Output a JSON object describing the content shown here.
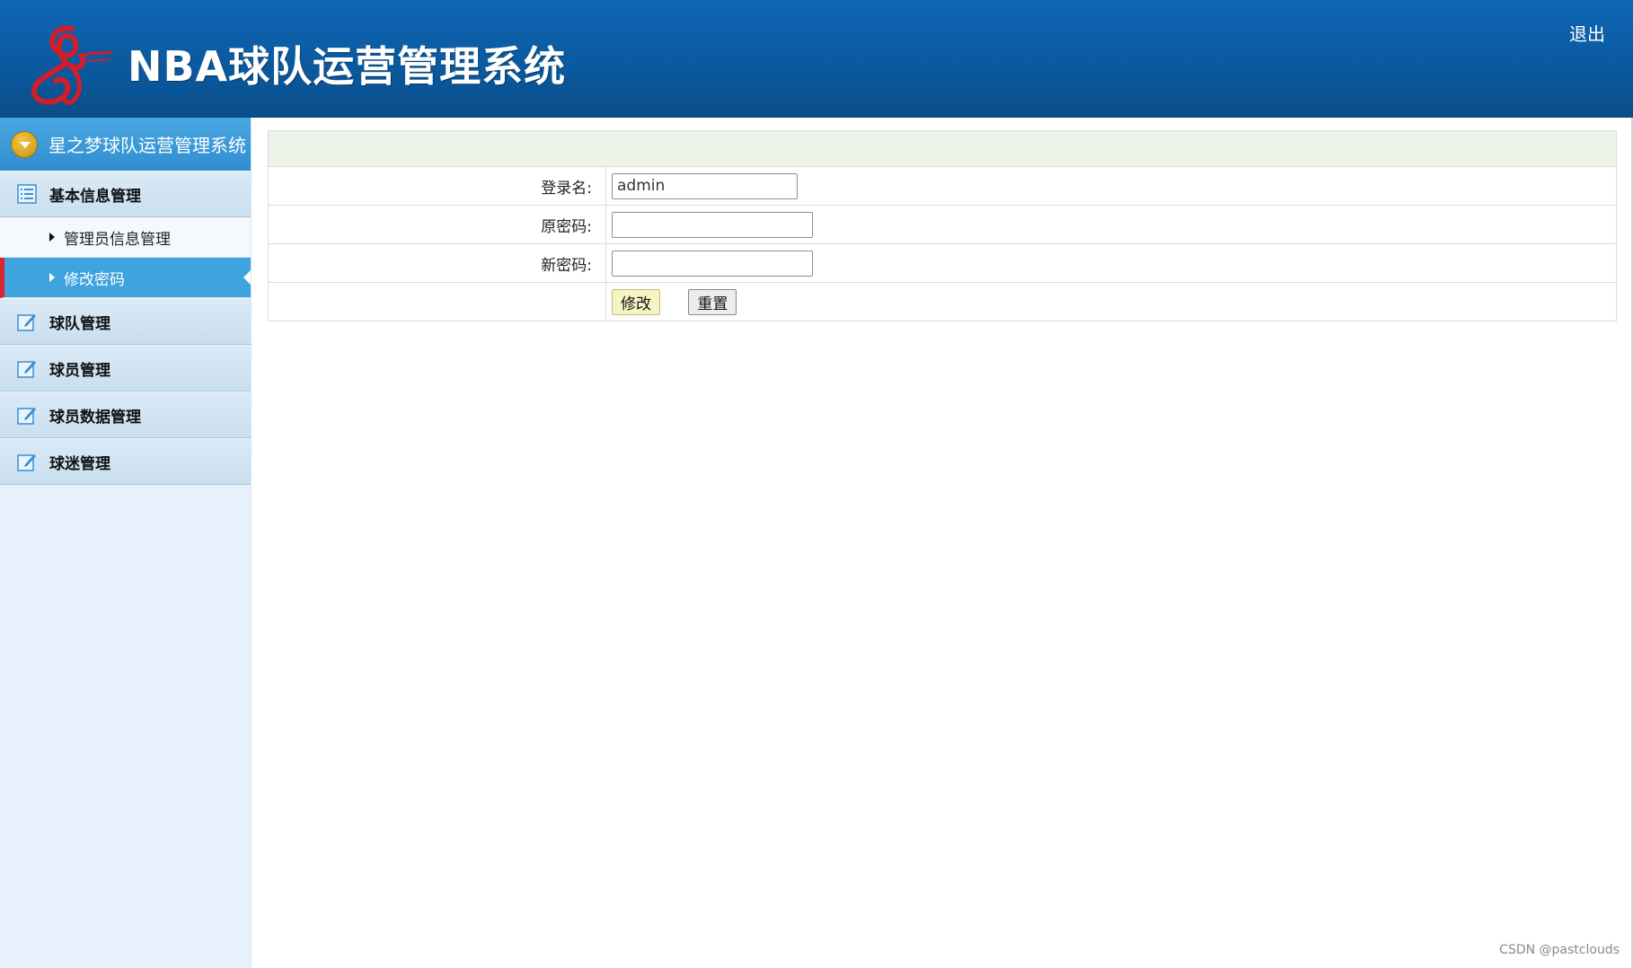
{
  "header": {
    "title": "NBA球队运营管理系统",
    "logout_label": "退出",
    "background_color": "#0b5aa0",
    "logo_icon": "red-ribbon-logo"
  },
  "sidebar": {
    "title": "星之梦球队运营管理系统",
    "groups": [
      {
        "label": "基本信息管理",
        "icon": "list-icon",
        "items": [
          {
            "label": "管理员信息管理",
            "active": false
          },
          {
            "label": "修改密码",
            "active": true
          }
        ]
      },
      {
        "label": "球队管理",
        "icon": "edit-icon",
        "items": []
      },
      {
        "label": "球员管理",
        "icon": "edit-icon",
        "items": []
      },
      {
        "label": "球员数据管理",
        "icon": "edit-icon",
        "items": []
      },
      {
        "label": "球迷管理",
        "icon": "edit-icon",
        "items": []
      }
    ],
    "active_color": "#3fa3de",
    "active_marker_color": "#d7262f"
  },
  "form": {
    "login_name_label": "登录名:",
    "login_name_value": "admin",
    "old_password_label": "原密码:",
    "old_password_value": "",
    "new_password_label": "新密码:",
    "new_password_value": "",
    "submit_label": "修改",
    "reset_label": "重置",
    "header_color": "#eef3ea"
  },
  "watermark": "CSDN @pastclouds"
}
